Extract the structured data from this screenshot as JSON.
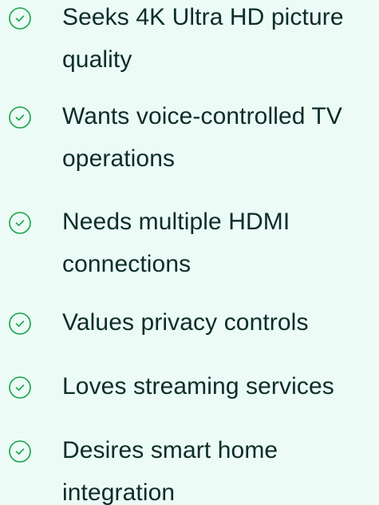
{
  "accent_color": "#16a34a",
  "icon": "check-circle-icon",
  "features": [
    {
      "label": "Seeks 4K Ultra HD picture quality"
    },
    {
      "label": "Wants voice-controlled TV operations"
    },
    {
      "label": "Needs multiple HDMI connections"
    },
    {
      "label": "Values privacy controls"
    },
    {
      "label": "Loves streaming services"
    },
    {
      "label": "Desires smart home integration"
    }
  ]
}
